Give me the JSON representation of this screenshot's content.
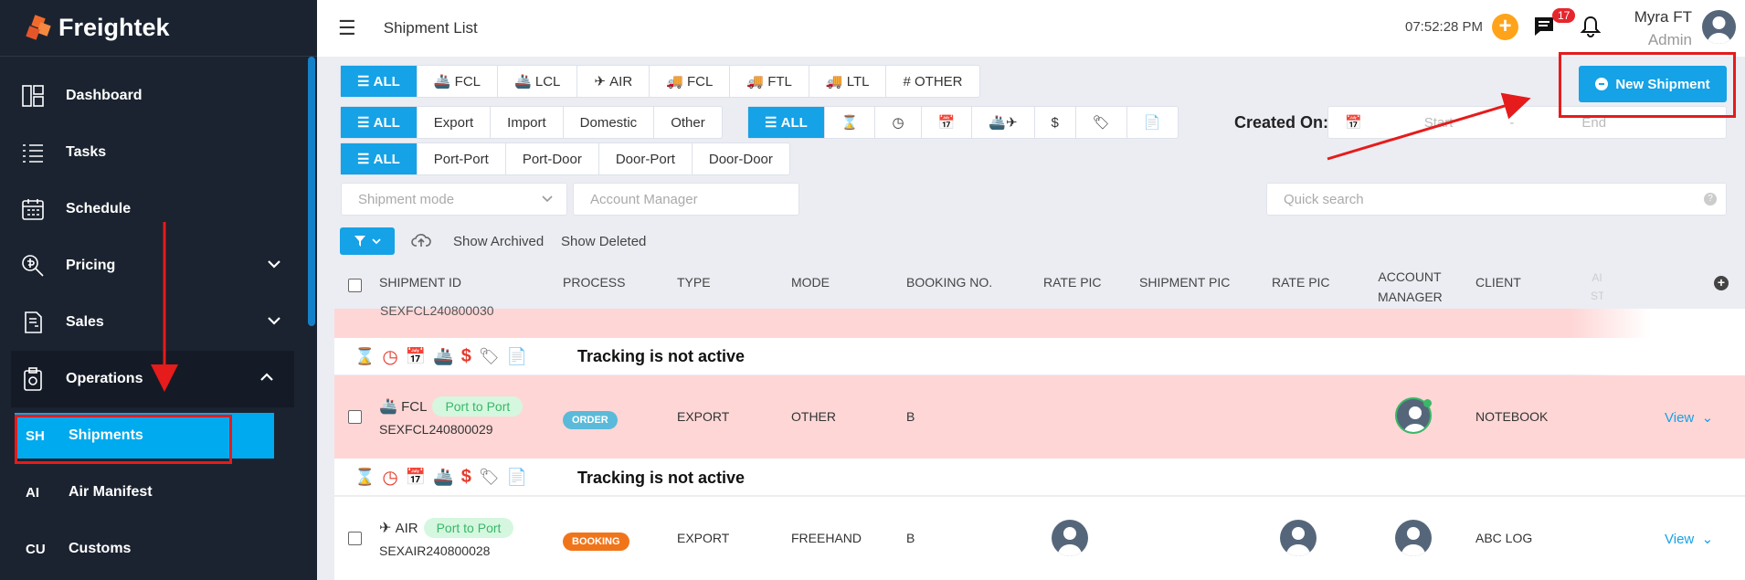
{
  "sidebar": {
    "brand": "Freightek",
    "items": [
      {
        "label": "Dashboard",
        "icon": "dashboard-icon"
      },
      {
        "label": "Tasks",
        "icon": "tasks-icon"
      },
      {
        "label": "Schedule",
        "icon": "calendar-icon"
      },
      {
        "label": "Pricing",
        "icon": "pricing-icon"
      },
      {
        "label": "Sales",
        "icon": "sales-icon"
      },
      {
        "label": "Operations",
        "icon": "clipboard-icon"
      }
    ],
    "subitems": [
      {
        "abbr": "SH",
        "label": "Shipments"
      },
      {
        "abbr": "AI",
        "label": "Air Manifest"
      },
      {
        "abbr": "CU",
        "label": "Customs"
      }
    ]
  },
  "header": {
    "title": "Shipment List",
    "time": "07:52:28 PM",
    "notification_count": "17",
    "user_name": "Myra FT",
    "user_role": "Admin"
  },
  "filters": {
    "type_buttons": [
      "ALL",
      "FCL",
      "LCL",
      "AIR",
      "FCL",
      "FTL",
      "LTL",
      "# OTHER"
    ],
    "direction_buttons": [
      "ALL",
      "Export",
      "Import",
      "Domestic",
      "Other"
    ],
    "status_buttons": [
      "ALL"
    ],
    "route_buttons": [
      "ALL",
      "Port-Port",
      "Port-Door",
      "Door-Port",
      "Door-Door"
    ],
    "created_on_label": "Created On:",
    "start_placeholder": "Start",
    "range_sep": "-",
    "end_placeholder": "End",
    "shipment_mode_placeholder": "Shipment mode",
    "account_manager_placeholder": "Account Manager",
    "quick_search_placeholder": "Quick search",
    "show_archived": "Show Archived",
    "show_deleted": "Show Deleted"
  },
  "new_shipment_label": "New Shipment",
  "table": {
    "headers": [
      "SHIPMENT ID",
      "PROCESS",
      "TYPE",
      "MODE",
      "BOOKING NO.",
      "RATE PIC",
      "SHIPMENT PIC",
      "RATE PIC",
      "ACCOUNT MANAGER",
      "CLIENT",
      "AI ST"
    ],
    "partial_id": "SEXFCL240800030",
    "tracking_text": "Tracking is not active",
    "rows": [
      {
        "mode_label": "FCL",
        "route": "Port to Port",
        "id": "SEXFCL240800029",
        "process": "ORDER",
        "type": "EXPORT",
        "mode": "OTHER",
        "booking": "B",
        "client": "NOTEBOOK",
        "view": "View"
      },
      {
        "mode_label": "AIR",
        "route": "Port to Port",
        "id": "SEXAIR240800028",
        "process": "BOOKING",
        "type": "EXPORT",
        "mode": "FREEHAND",
        "booking": "B",
        "client": "ABC LOG",
        "view": "View"
      }
    ]
  },
  "colors": {
    "accent": "#15a2e6",
    "sidebar": "#1b2330",
    "annotation": "#e61b1b",
    "row_highlight": "#ffd6d6"
  }
}
